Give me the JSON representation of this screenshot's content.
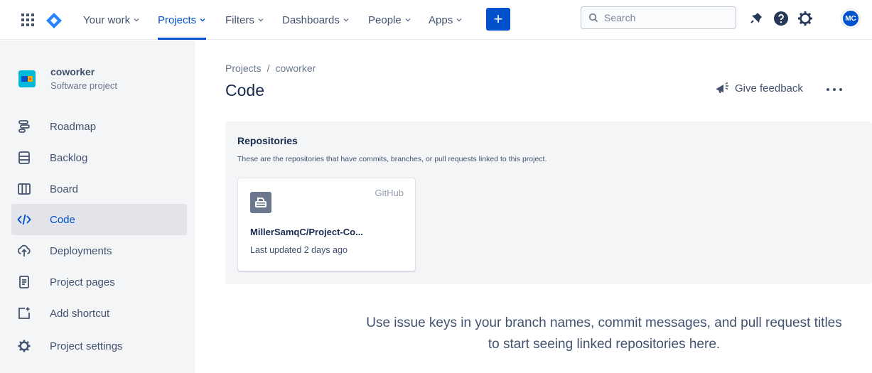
{
  "nav": {
    "items": [
      {
        "label": "Your work"
      },
      {
        "label": "Projects"
      },
      {
        "label": "Filters"
      },
      {
        "label": "Dashboards"
      },
      {
        "label": "People"
      },
      {
        "label": "Apps"
      }
    ],
    "create_label": "+",
    "search_placeholder": "Search",
    "avatar_initials": "MC",
    "accent": "#0052CC"
  },
  "sidebar": {
    "project_name": "coworker",
    "project_type": "Software project",
    "items": [
      {
        "label": "Roadmap",
        "icon": "roadmap-icon"
      },
      {
        "label": "Backlog",
        "icon": "backlog-icon"
      },
      {
        "label": "Board",
        "icon": "board-icon"
      },
      {
        "label": "Code",
        "icon": "code-icon",
        "active": true
      },
      {
        "label": "Deployments",
        "icon": "deployments-icon"
      },
      {
        "label": "Project pages",
        "icon": "pages-icon"
      },
      {
        "label": "Add shortcut",
        "icon": "add-shortcut-icon"
      },
      {
        "label": "Project settings",
        "icon": "settings-icon"
      }
    ]
  },
  "main": {
    "breadcrumb": {
      "root": "Projects",
      "separator": "/",
      "project": "coworker"
    },
    "title": "Code",
    "feedback_label": "Give feedback",
    "repositories": {
      "heading": "Repositories",
      "description": "These are the repositories that have commits, branches, or pull requests linked to this project.",
      "card": {
        "host": "GitHub",
        "name": "MillerSamqC/Project-Co...",
        "updated": "Last updated 2 days ago"
      }
    },
    "empty_message_line1": "Use issue keys in your branch names, commit messages, and pull request titles",
    "empty_message_line2": "to start seeing linked repositories here."
  }
}
